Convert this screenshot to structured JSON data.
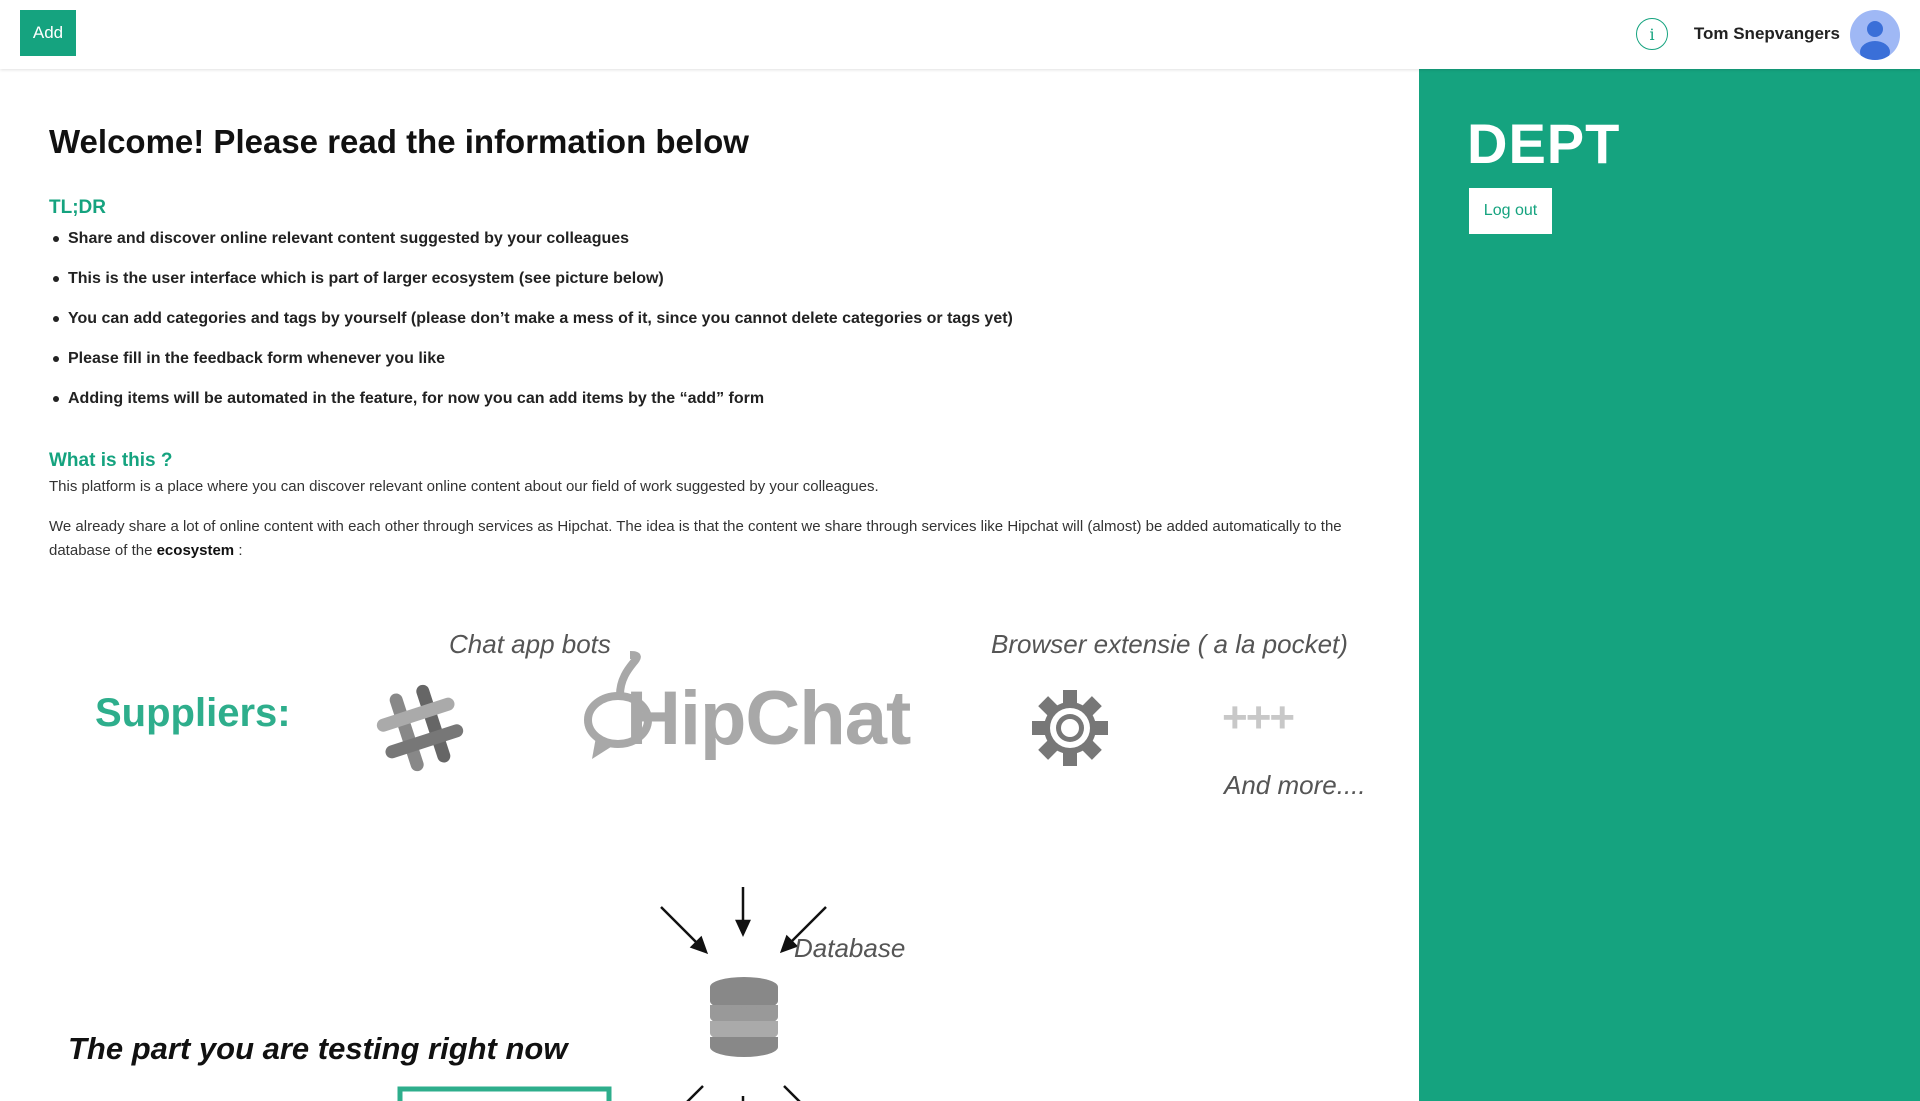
{
  "topbar": {
    "add_label": "Add",
    "info_label": "i",
    "user_name": "Tom Snepvangers"
  },
  "main": {
    "welcome_title": "Welcome! Please read the information below",
    "tldr_title": "TL;DR",
    "bullets": [
      "Share and discover online relevant content suggested by your colleagues",
      "This is the user interface which is part of larger ecosystem (see picture below)",
      "You can add categories and tags by yourself (please don’t make a mess of it, since you cannot delete categories or tags yet)",
      "Please fill in the feedback form whenever you like",
      "Adding items will be automated in the feature, for now you can add items by the “add” form"
    ],
    "what_title": "What is this ?",
    "para1": "This platform is a place where you can discover relevant online content about our field of work suggested by your colleagues.",
    "para2_text": "We already share a lot of online content with each other through services as Hipchat. The idea is that the content we share through services like Hipchat will (almost) be added au­tomatically to the database of the ",
    "para2_bold": "ecosystem",
    "para2_end": " :"
  },
  "figure": {
    "chat_bots_label": "Chat app bots",
    "browser_label": "Browser extensie ( a la pocket)",
    "suppliers_label": "Suppliers:",
    "hipchat_label": "HipChat",
    "plus_label": "+++",
    "and_more_label": "And more....",
    "database_label": "Database",
    "testing_label": "The part you are testing right now"
  },
  "sidebar": {
    "brand": "DEPT",
    "logout_label": "Log out"
  },
  "colors": {
    "accent": "#15a37f",
    "suppliers_green": "#2eae8c",
    "avatar_bg": "#9fb8f5",
    "icon_gray": "#7a7a7a"
  }
}
